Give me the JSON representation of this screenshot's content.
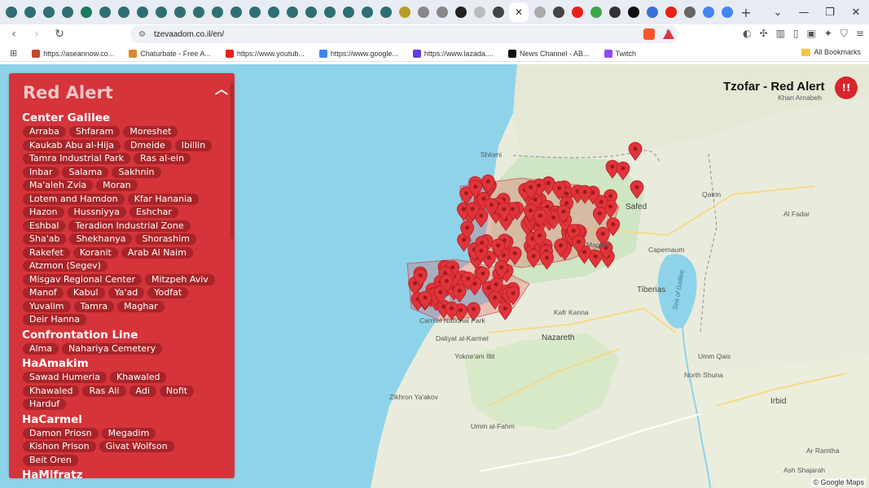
{
  "browser": {
    "tabs": [
      {
        "icon": "generic-favicon",
        "color": "#2f6f73"
      },
      {
        "icon": "generic-favicon",
        "color": "#2f6f73"
      },
      {
        "icon": "generic-favicon",
        "color": "#2f6f73"
      },
      {
        "icon": "generic-favicon",
        "color": "#2f6f73"
      },
      {
        "icon": "s-favicon",
        "color": "#1e7a5c"
      },
      {
        "icon": "generic-favicon",
        "color": "#2f6f73"
      },
      {
        "icon": "generic-favicon",
        "color": "#2f6f73"
      },
      {
        "icon": "generic-favicon",
        "color": "#2f6f73"
      },
      {
        "icon": "generic-favicon",
        "color": "#2f6f73"
      },
      {
        "icon": "generic-favicon",
        "color": "#2f6f73"
      },
      {
        "icon": "generic-favicon",
        "color": "#2f6f73"
      },
      {
        "icon": "generic-favicon",
        "color": "#2f6f73"
      },
      {
        "icon": "generic-favicon",
        "color": "#2f6f73"
      },
      {
        "icon": "generic-favicon",
        "color": "#2f6f73"
      },
      {
        "icon": "generic-favicon",
        "color": "#2f6f73"
      },
      {
        "icon": "generic-favicon",
        "color": "#2f6f73"
      },
      {
        "icon": "generic-favicon",
        "color": "#2f6f73"
      },
      {
        "icon": "generic-favicon",
        "color": "#2f6f73"
      },
      {
        "icon": "generic-favicon",
        "color": "#2f6f73"
      },
      {
        "icon": "generic-favicon",
        "color": "#2f6f73"
      },
      {
        "icon": "generic-favicon",
        "color": "#2f6f73"
      },
      {
        "icon": "generic-favicon",
        "color": "#b69b2a"
      },
      {
        "icon": "generic-favicon",
        "color": "#888888"
      },
      {
        "icon": "generic-favicon",
        "color": "#888888"
      },
      {
        "icon": "generic-favicon",
        "color": "#222222"
      },
      {
        "icon": "generic-favicon",
        "color": "#bbbbbb"
      },
      {
        "icon": "generic-favicon",
        "color": "#444444"
      }
    ],
    "active_tab_close": "✕",
    "tabs_after": [
      {
        "icon": "google-favicon",
        "color": "#aaaaaa"
      },
      {
        "icon": "generic-favicon",
        "color": "#444444"
      },
      {
        "icon": "youtube-favicon",
        "color": "#e62117"
      },
      {
        "icon": "generic-favicon",
        "color": "#3aa74a"
      },
      {
        "icon": "generic-favicon",
        "color": "#333333"
      },
      {
        "icon": "x-favicon",
        "color": "#111111"
      },
      {
        "icon": "generic-favicon",
        "color": "#3b6fd8"
      },
      {
        "icon": "youtube-favicon",
        "color": "#e62117"
      },
      {
        "icon": "audio-favicon",
        "color": "#666666"
      },
      {
        "icon": "google-favicon",
        "color": "#4285f4"
      },
      {
        "icon": "google-favicon",
        "color": "#4285f4"
      }
    ],
    "new_tab": "+",
    "url": "tzevaadom.co.il/en/",
    "bookmarks": [
      {
        "label": "https://aseannow.co...",
        "color": "#c4452a"
      },
      {
        "label": "Chaturbate - Free A...",
        "color": "#d98a29"
      },
      {
        "label": "https://www.youtub...",
        "color": "#e62117"
      },
      {
        "label": "https://www.google...",
        "color": "#4285f4"
      },
      {
        "label": "https://www.lazada....",
        "color": "#6a3be0"
      },
      {
        "label": "News Channel - AB...",
        "color": "#111111"
      },
      {
        "label": "Twitch",
        "color": "#9146ff"
      }
    ],
    "all_bookmarks": "All Bookmarks"
  },
  "map": {
    "title": "Tzofar - Red Alert",
    "credit": "© Google Maps",
    "places": [
      {
        "name": "Shlomi"
      },
      {
        "name": "Safed"
      },
      {
        "name": "Qatrin"
      },
      {
        "name": "Al Fadar"
      },
      {
        "name": "Maghar"
      },
      {
        "name": "Capernaum"
      },
      {
        "name": "Sea of Galilee"
      },
      {
        "name": "Tiberias"
      },
      {
        "name": "Kafr Kanna"
      },
      {
        "name": "Nazareth"
      },
      {
        "name": "Daliyat al-Karmel"
      },
      {
        "name": "Yokne'am Illit"
      },
      {
        "name": "Umm Qais"
      },
      {
        "name": "North Shuna"
      },
      {
        "name": "Irbid"
      },
      {
        "name": "Ar Ramtha"
      },
      {
        "name": "Zikhron Ya'akov"
      },
      {
        "name": "Umm al-Fahm"
      },
      {
        "name": "Ash Shajarah"
      },
      {
        "name": "Khan Arnabeh"
      },
      {
        "name": "Carmel National Park"
      }
    ]
  },
  "alerts": {
    "title": "Red Alert",
    "collapse_icon": "chevron-up-icon",
    "areas": [
      {
        "name": "Center Galilee",
        "towns": [
          "Arraba",
          "Shfaram",
          "Moreshet",
          "Kaukab Abu al-Hija",
          "Dmeide",
          "Ibillin",
          "Tamra Industrial Park",
          "Ras al-ein",
          "Inbar",
          "Salama",
          "Sakhnin",
          "Ma'aleh Zvia",
          "Moran",
          "Lotem and Hamdon",
          "Kfar Hanania",
          "Hazon",
          "Hussniyya",
          "Eshchar",
          "Eshbal",
          "Teradion Industrial Zone",
          "Sha'ab",
          "Shekhanya",
          "Shorashim",
          "Rakefet",
          "Koranit",
          "Arab Al Naim",
          "Atzmon (Segev)",
          "Misgav Regional Center",
          "Mitzpeh Aviv",
          "Manof",
          "Kabul",
          "Ya'ad",
          "Yodfat",
          "Yuvalim",
          "Tamra",
          "Maghar",
          "Deir Hanna"
        ]
      },
      {
        "name": "Confrontation Line",
        "towns": [
          "Alma",
          "Nahariya Cemetery"
        ]
      },
      {
        "name": "HaAmakim",
        "towns": [
          "Sawad Humeria",
          "Khawaled",
          "Khawaled",
          "Ras Ali",
          "Adi",
          "Nofit",
          "Harduf"
        ]
      },
      {
        "name": "HaCarmel",
        "towns": [
          "Damon Priosn",
          "Megadim",
          "Kishon Prison",
          "Givat Wolfson",
          "Beit Oren"
        ]
      },
      {
        "name": "HaMifratz",
        "towns": []
      }
    ]
  }
}
